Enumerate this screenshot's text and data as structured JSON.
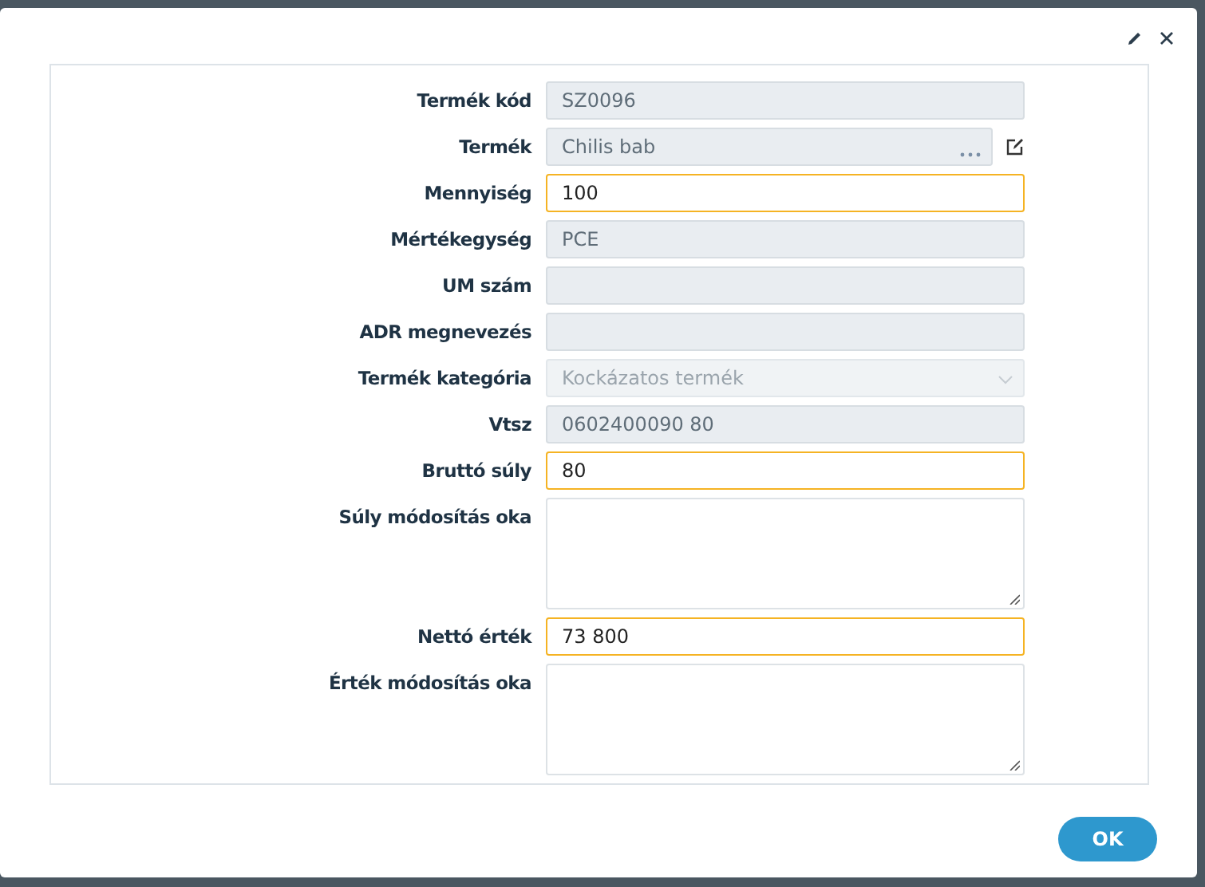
{
  "fields": [
    {
      "label": "Termék kód",
      "value": "SZ0096",
      "kind": "readonly"
    },
    {
      "label": "Termék",
      "value": "Chilis bab",
      "kind": "lookup"
    },
    {
      "label": "Mennyiség",
      "value": "100",
      "kind": "input"
    },
    {
      "label": "Mértékegység",
      "value": "PCE",
      "kind": "readonly"
    },
    {
      "label": "UM szám",
      "kind": "readonly"
    },
    {
      "label": "ADR megnevezés",
      "kind": "readonly"
    },
    {
      "label": "Termék kategória",
      "value": "Kockázatos termék",
      "kind": "select"
    },
    {
      "label": "Vtsz",
      "value": "0602400090 80",
      "kind": "readonly"
    },
    {
      "label": "Bruttó súly",
      "value": "80",
      "kind": "input"
    },
    {
      "label": "Súly módosítás oka",
      "kind": "textarea"
    },
    {
      "label": "Nettó érték",
      "value": "73 800",
      "kind": "input"
    },
    {
      "label": "Érték módosítás oka",
      "kind": "textarea"
    }
  ],
  "ok_button": "OK"
}
